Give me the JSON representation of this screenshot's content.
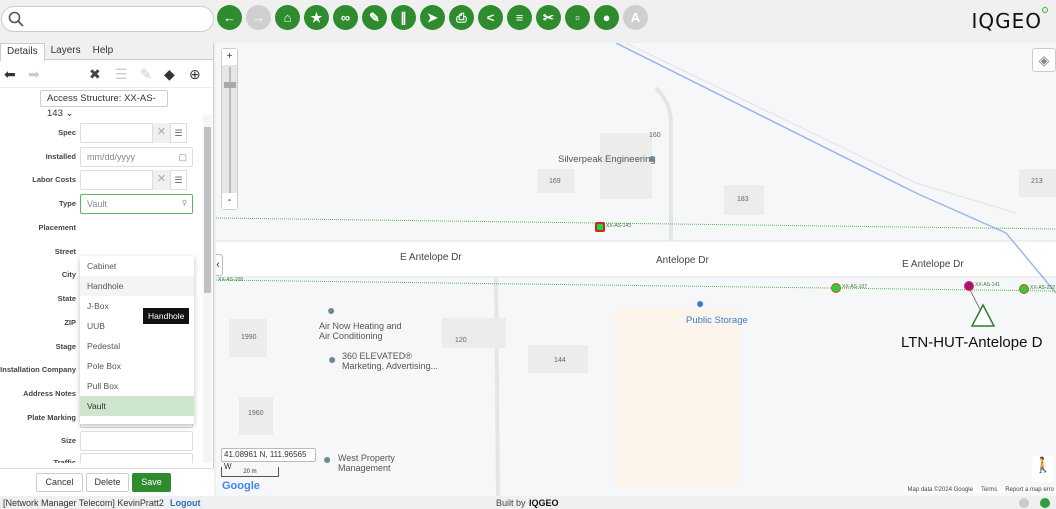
{
  "topbar": {
    "search_placeholder": "",
    "logo": "IQGEO",
    "tools": [
      {
        "name": "back",
        "glyph": "←"
      },
      {
        "name": "forward",
        "glyph": "→",
        "disabled": true
      },
      {
        "name": "home",
        "glyph": "⌂"
      },
      {
        "name": "bookmark",
        "glyph": "★"
      },
      {
        "name": "link",
        "glyph": "∞"
      },
      {
        "name": "edit",
        "glyph": "✎"
      },
      {
        "name": "measure",
        "glyph": "∥"
      },
      {
        "name": "location",
        "glyph": "➤"
      },
      {
        "name": "print",
        "glyph": "⎙"
      },
      {
        "name": "share",
        "glyph": "<"
      },
      {
        "name": "tree",
        "glyph": "≡"
      },
      {
        "name": "tools",
        "glyph": "✂"
      },
      {
        "name": "network",
        "glyph": "▫"
      },
      {
        "name": "trace",
        "glyph": "●"
      },
      {
        "name": "annotate",
        "glyph": "A",
        "disabled": true
      }
    ]
  },
  "panel": {
    "tabs": [
      "Details",
      "Layers",
      "Help"
    ],
    "feature_select": "Access Structure: XX-AS-143 ⌄",
    "fields": [
      {
        "label": "Spec",
        "value": "",
        "type": "clear-list"
      },
      {
        "label": "Installed",
        "value": "mm/dd/yyyy",
        "type": "date"
      },
      {
        "label": "Labor Costs",
        "value": "",
        "type": "clear-list"
      },
      {
        "label": "Type",
        "value": "Vault",
        "type": "search"
      },
      {
        "label": "Placement"
      },
      {
        "label": "Street"
      },
      {
        "label": "City"
      },
      {
        "label": "State"
      },
      {
        "label": "ZIP"
      },
      {
        "label": "Stage"
      },
      {
        "label": "Installation Company"
      },
      {
        "label": "Address Notes",
        "type": "textarea"
      },
      {
        "label": "Plate Marking",
        "type": "text"
      },
      {
        "label": "Size",
        "type": "text"
      },
      {
        "label": "Traffic",
        "type": "text"
      }
    ],
    "dropdown_options": [
      "Cabinet",
      "Handhole",
      "J-Box",
      "UUB",
      "Pedestal",
      "Pole Box",
      "Pull Box",
      "Vault"
    ],
    "hovered_option": "Handhole",
    "selected_option": "Vault",
    "tooltip": "Handhole",
    "buttons": {
      "cancel": "Cancel",
      "delete": "Delete",
      "save": "Save"
    }
  },
  "map": {
    "roads": [
      "E Antelope Dr",
      "Antelope Dr",
      "E Antelope Dr"
    ],
    "places": [
      "Silverpeak Engineering",
      "Public Storage",
      "Air Now Heating and Air Conditioning",
      "360 ELEVATED® Marketing. Advertising...",
      "West Property Management"
    ],
    "building_numbers": [
      "160",
      "169",
      "183",
      "213",
      "1990",
      "120",
      "144",
      "1960"
    ],
    "structures": [
      "XX-AS-143",
      "XX-AS-107",
      "XX-AS-141",
      "XX-AS-252",
      "XX-AS-108"
    ],
    "hut_label": "LTN-HUT-Antelope D",
    "coordinates": "41.08961 N, 111.96565 W",
    "scale": "20 m",
    "google": "Google",
    "attribution": {
      "data": "Map data ©2024 Google",
      "terms": "Terms",
      "report": "Report a map erro"
    },
    "zoom_in": "+",
    "zoom_out": "-"
  },
  "footer": {
    "user": "[Network Manager Telecom] KevinPratt2",
    "logout": "Logout",
    "built_by": "Built by",
    "brand": "IQGEO"
  }
}
